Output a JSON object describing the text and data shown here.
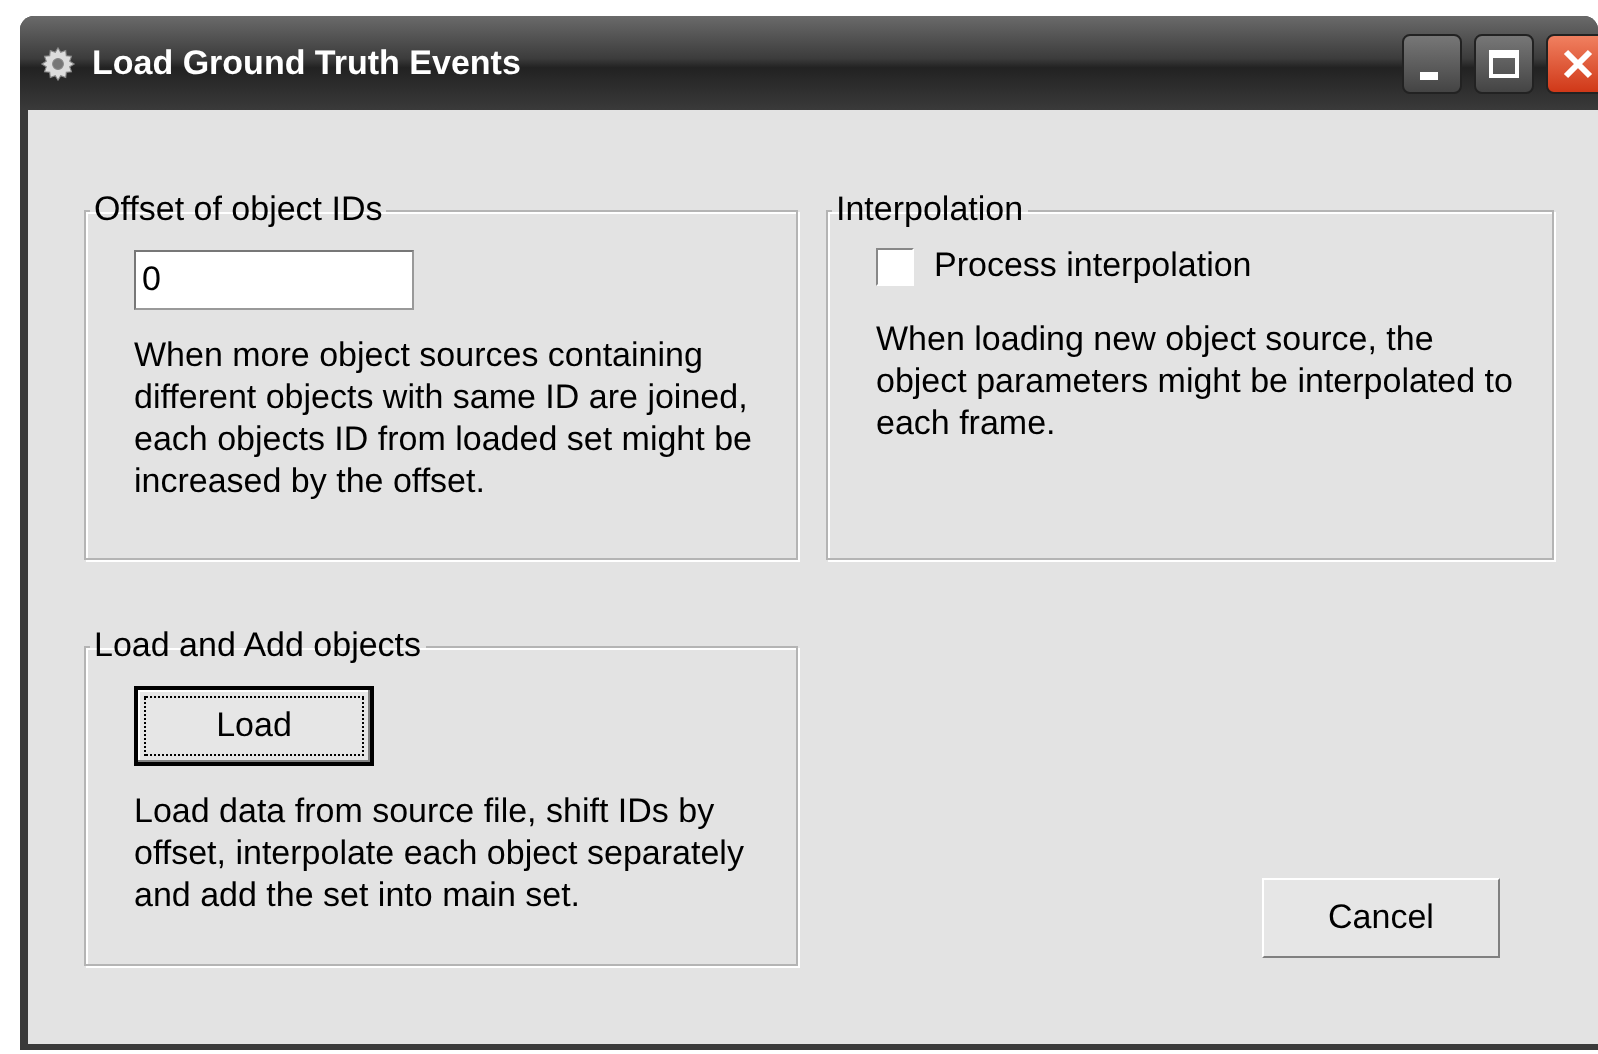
{
  "window": {
    "title": "Load Ground Truth Events"
  },
  "offset_group": {
    "title": "Offset of object IDs",
    "value": "0",
    "description": "When more object sources containing different objects with same ID are joined, each objects ID from loaded set might be increased by the offset."
  },
  "interpolation_group": {
    "title": "Interpolation",
    "checkbox": {
      "label": "Process interpolation",
      "checked": false
    },
    "description": "When loading new object source, the object parameters might be interpolated to each frame."
  },
  "load_group": {
    "title": "Load and Add objects",
    "button": {
      "label": "Load",
      "focused": true
    },
    "description": "Load data from source file, shift IDs by offset, interpolate each object separately and add the set into main set."
  },
  "buttons": [
    "Cancel"
  ]
}
